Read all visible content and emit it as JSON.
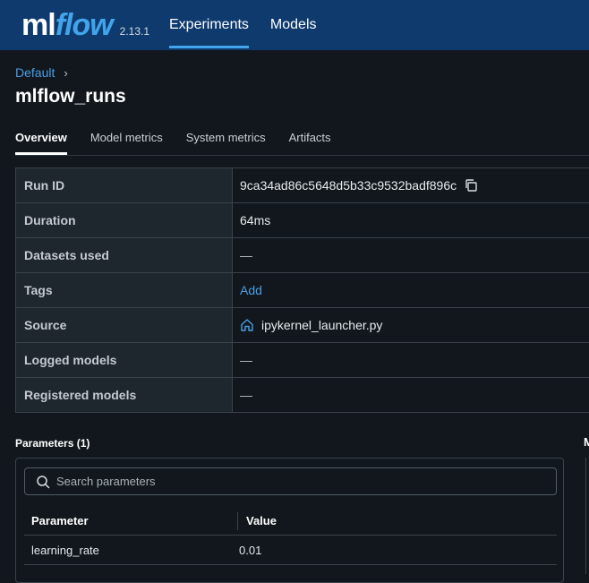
{
  "app": {
    "logo_ml": "ml",
    "logo_flow": "flow",
    "version": "2.13.1",
    "nav": [
      {
        "label": "Experiments",
        "active": true
      },
      {
        "label": "Models",
        "active": false
      }
    ],
    "accent_color": "#42a4ea",
    "header_color": "#0e3a6e"
  },
  "breadcrumb": {
    "parent": "Default",
    "separator": "›"
  },
  "page": {
    "title": "mlflow_runs"
  },
  "tabs": [
    {
      "label": "Overview",
      "active": true
    },
    {
      "label": "Model metrics",
      "active": false
    },
    {
      "label": "System metrics",
      "active": false
    },
    {
      "label": "Artifacts",
      "active": false
    }
  ],
  "run_info": {
    "run_id_label": "Run ID",
    "run_id": "9ca34ad86c5648d5b33c9532badf896c",
    "duration_label": "Duration",
    "duration": "64ms",
    "datasets_label": "Datasets used",
    "datasets": "—",
    "tags_label": "Tags",
    "tags_add": "Add",
    "source_label": "Source",
    "source": "ipykernel_launcher.py",
    "logged_models_label": "Logged models",
    "logged_models": "—",
    "registered_models_label": "Registered models",
    "registered_models": "—"
  },
  "parameters": {
    "title": "Parameters (1)",
    "search_placeholder": "Search parameters",
    "col_param": "Parameter",
    "col_value": "Value",
    "rows": [
      {
        "name": "learning_rate",
        "value": "0.01"
      }
    ]
  },
  "metrics_fragment": {
    "title_clip": "M"
  }
}
